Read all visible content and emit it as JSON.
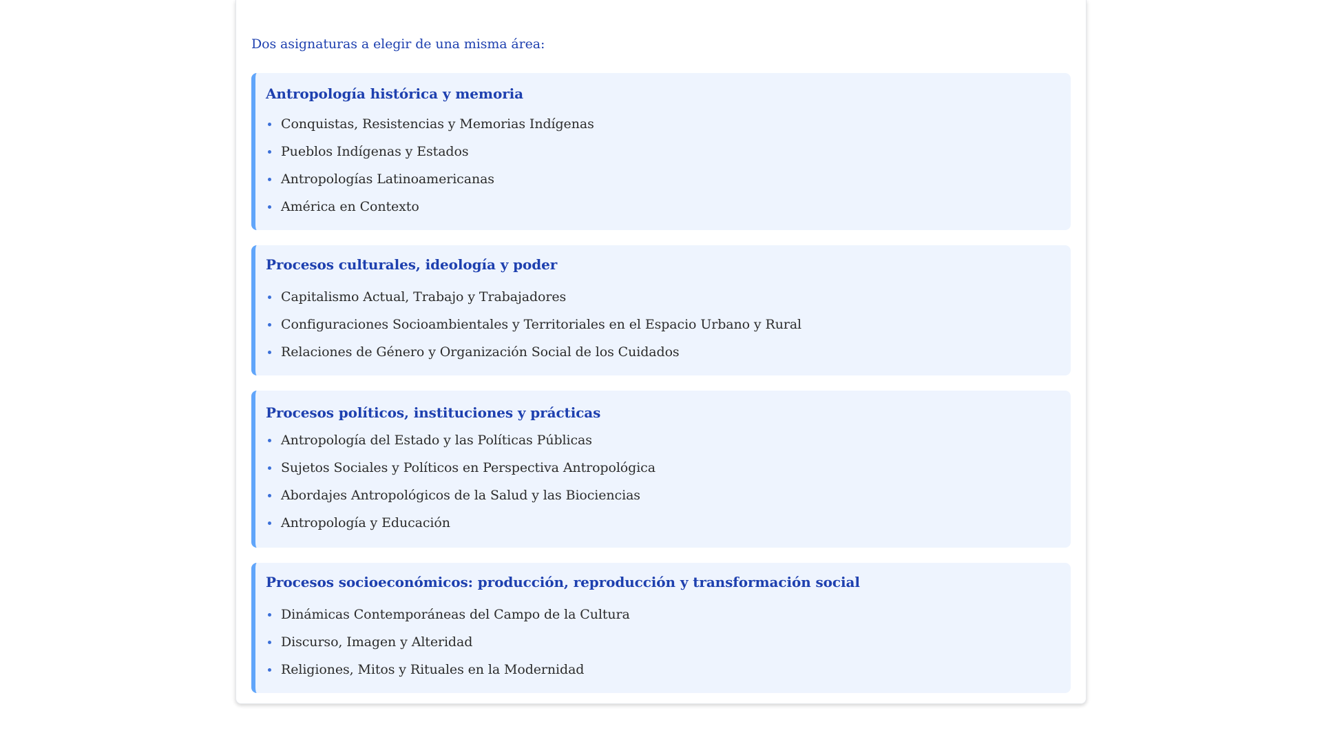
{
  "intro": "Dos asignaturas a elegir de una misma área:",
  "areas": [
    {
      "title": "Antropología histórica y memoria",
      "items": [
        "Conquistas, Resistencias y Memorias Indígenas",
        "Pueblos Indígenas y Estados",
        "Antropologías Latinoamericanas",
        "América en Contexto"
      ]
    },
    {
      "title": "Procesos culturales, ideología y poder",
      "items": [
        "Capitalismo Actual, Trabajo y Trabajadores",
        "Configuraciones Socioambientales y Territoriales en el Espacio Urbano y Rural",
        "Relaciones de Género y Organización Social de los Cuidados"
      ]
    },
    {
      "title": "Procesos políticos, instituciones y prácticas",
      "items": [
        "Antropología del Estado y las Políticas Públicas",
        "Sujetos Sociales y Políticos en Perspectiva Antropológica",
        "Abordajes Antropológicos de la Salud y las Biociencias",
        "Antropología y Educación"
      ]
    },
    {
      "title": "Procesos socioeconómicos: producción, reproducción y transformación social",
      "items": [
        "Dinámicas Contemporáneas del Campo de la Cultura",
        "Discurso, Imagen y Alteridad",
        "Religiones, Mitos y Rituales en la Modernidad"
      ]
    }
  ]
}
